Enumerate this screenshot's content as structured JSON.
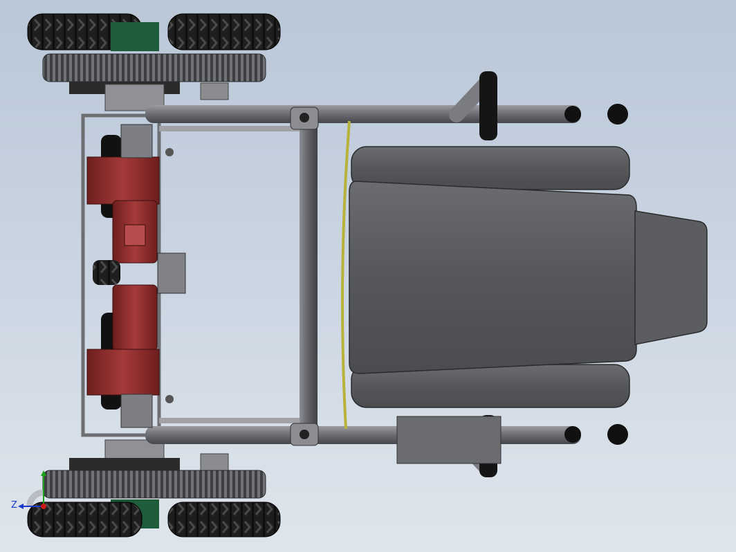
{
  "viewport": {
    "background_top": "#b9c7d8",
    "background_bottom": "#dfe5ec"
  },
  "model_colors": {
    "tire": "#1b1b1b",
    "frame": "#7d7f84",
    "motor": "#8e2b2b",
    "seat": "#56585c",
    "accent_green": "#1f5c3c"
  },
  "triad": {
    "x_label": "",
    "y_label": "",
    "z_label": "Z",
    "x_color": "#c81a1a",
    "y_color": "#1aa31a",
    "z_color": "#1a3cc8"
  }
}
